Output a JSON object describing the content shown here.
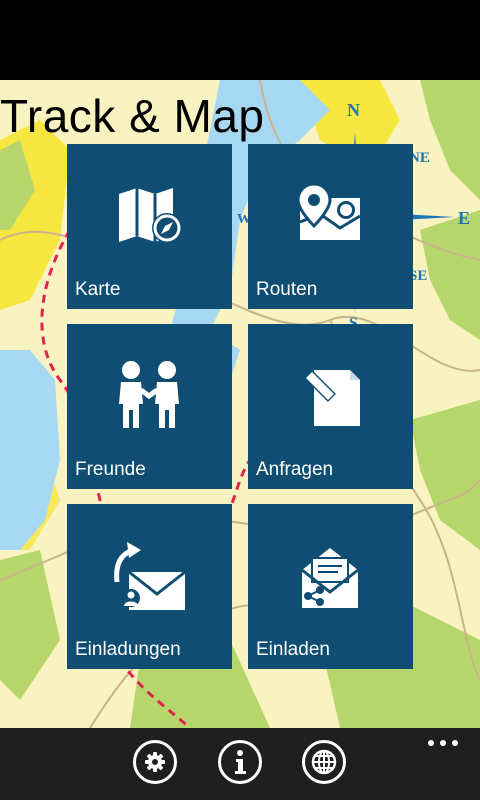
{
  "app": {
    "title": "Track & Map"
  },
  "tiles": [
    {
      "label": "Karte",
      "icon": "map-icon"
    },
    {
      "label": "Routen",
      "icon": "route-pin-icon"
    },
    {
      "label": "Freunde",
      "icon": "friends-icon"
    },
    {
      "label": "Anfragen",
      "icon": "request-edit-icon"
    },
    {
      "label": "Einladungen",
      "icon": "invitations-envelope-icon"
    },
    {
      "label": "Einladen",
      "icon": "invite-share-envelope-icon"
    }
  ],
  "compass": {
    "north": "N",
    "northeast": "NE",
    "east": "E",
    "southeast": "SE",
    "south": "S",
    "west": "W"
  },
  "appbar": {
    "buttons": [
      {
        "icon": "gear-icon"
      },
      {
        "icon": "info-icon"
      },
      {
        "icon": "globe-icon"
      }
    ],
    "more": "ellipsis-icon"
  },
  "colors": {
    "tile": "#0f4d72",
    "map_land": "#f8f3c0",
    "map_water": "#a6d8f2",
    "map_green": "#b6d66b",
    "map_yellow": "#f6e640",
    "route": "#e0234f",
    "appbar": "#1f1f1f"
  }
}
